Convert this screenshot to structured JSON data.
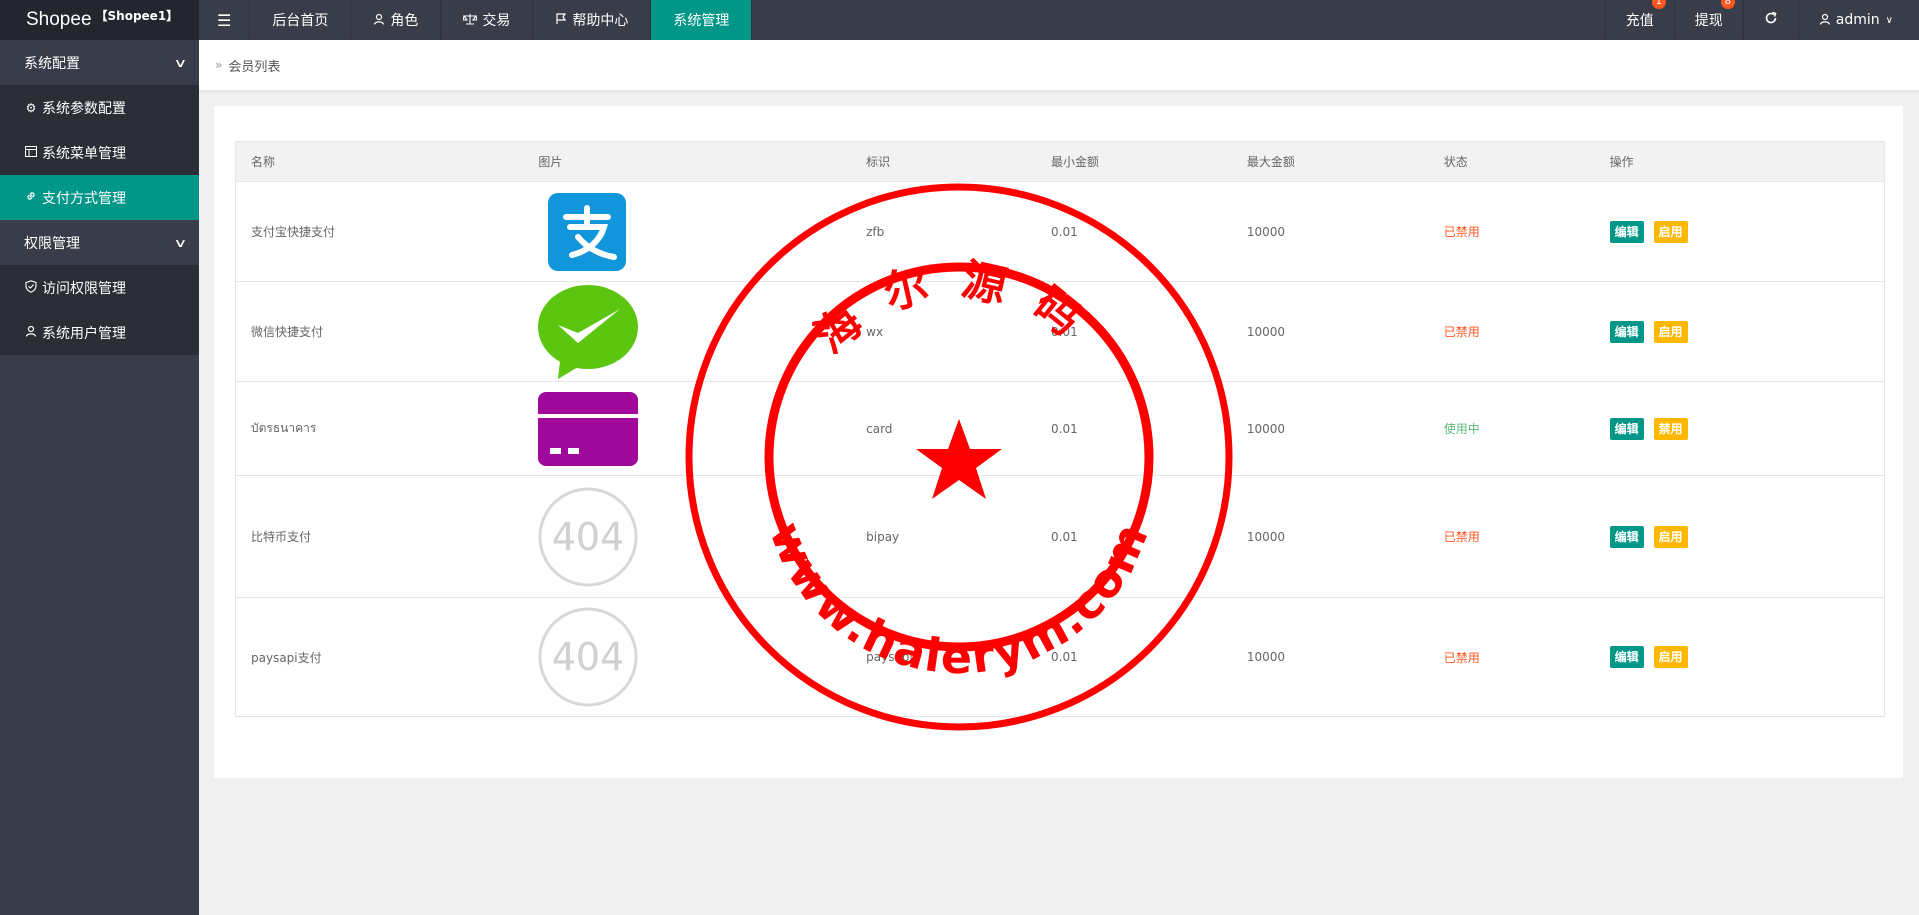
{
  "header": {
    "brand": "Shopee",
    "brand_sub": "【Shopee1】",
    "menu_icon": "hamburger-icon",
    "nav": [
      {
        "label": "后台首页",
        "icon": ""
      },
      {
        "label": "角色",
        "icon": "user-icon"
      },
      {
        "label": "交易",
        "icon": "scale-icon"
      },
      {
        "label": "帮助中心",
        "icon": "flag-icon"
      },
      {
        "label": "系统管理",
        "icon": ""
      }
    ],
    "right": {
      "recharge": "充值",
      "recharge_badge": "1",
      "withdraw": "提现",
      "withdraw_badge": "8",
      "refresh_icon": "refresh-icon",
      "user": "admin"
    }
  },
  "sidebar": {
    "group1": "系统配置",
    "items1": [
      "系统参数配置",
      "系统菜单管理",
      "支付方式管理"
    ],
    "group2": "权限管理",
    "items2": [
      "访问权限管理",
      "系统用户管理"
    ]
  },
  "breadcrumb": "会员列表",
  "table": {
    "headers": [
      "名称",
      "图片",
      "标识",
      "最小金额",
      "最大金额",
      "状态",
      "操作"
    ],
    "rows": [
      {
        "name": "支付宝快捷支付",
        "icon": "alipay-icon",
        "code": "zfb",
        "min": "0.01",
        "max": "10000",
        "status": "已禁用",
        "edit": "编辑",
        "toggle": "启用"
      },
      {
        "name": "微信快捷支付",
        "icon": "wechat-icon",
        "code": "wx",
        "min": "0.01",
        "max": "10000",
        "status": "已禁用",
        "edit": "编辑",
        "toggle": "启用"
      },
      {
        "name": "บัตรธนาคาร",
        "icon": "card-icon",
        "code": "card",
        "min": "0.01",
        "max": "10000",
        "status": "使用中",
        "edit": "编辑",
        "toggle": "禁用"
      },
      {
        "name": "比特币支付",
        "icon": "404-icon",
        "code": "bipay",
        "min": "0.01",
        "max": "10000",
        "status": "已禁用",
        "edit": "编辑",
        "toggle": "启用"
      },
      {
        "name": "paysapi支付",
        "icon": "404-icon",
        "code": "paysapi",
        "min": "0.01",
        "max": "10000",
        "status": "已禁用",
        "edit": "编辑",
        "toggle": "启用"
      }
    ],
    "placeholder_text": "404"
  },
  "watermark": {
    "top_text": "海尔源码",
    "bottom_text": "www.haierym.com"
  },
  "colors": {
    "accent": "#009688",
    "warn": "#ffb800",
    "danger": "#ff5722",
    "success": "#5fb878",
    "stamp": "#ff0000"
  }
}
